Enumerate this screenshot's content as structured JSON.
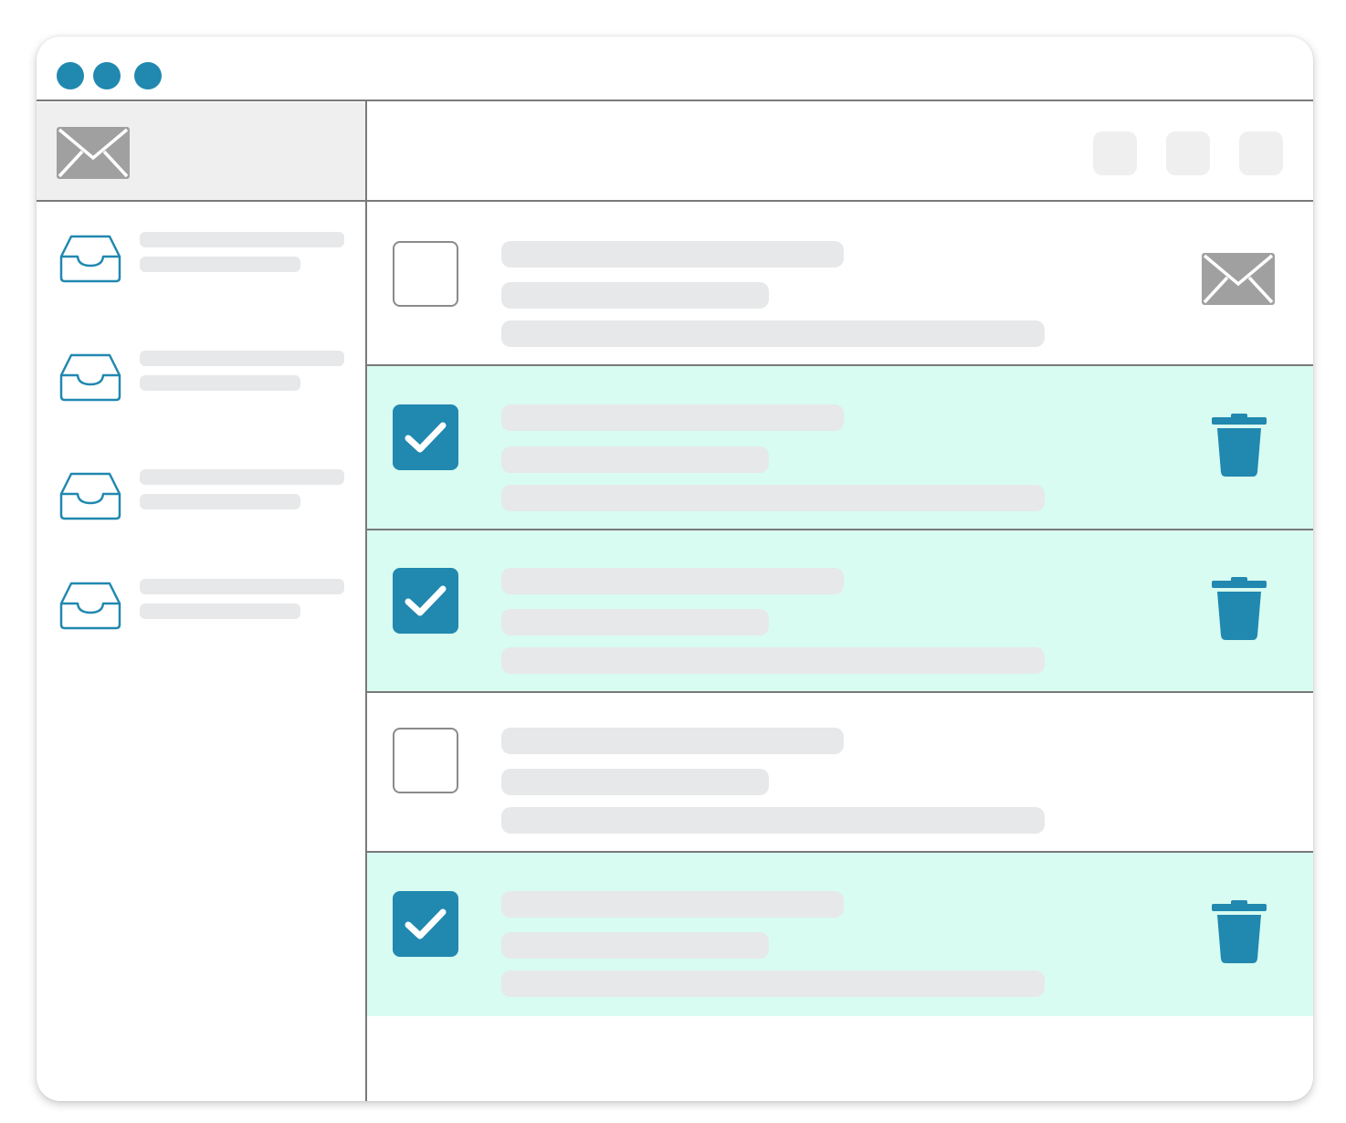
{
  "colors": {
    "accent": "#2188b0",
    "selected_row_bg": "#d8fcf1",
    "envelope_gray": "#a0a0a0"
  },
  "icons": {
    "window_controls": [
      "window-dot-icon",
      "window-dot-icon",
      "window-dot-icon"
    ],
    "app_logo": "envelope-icon",
    "folder": "inbox-tray-icon",
    "row_unread": "envelope-icon",
    "row_delete": "trash-icon",
    "checkbox_checked": "checkmark-icon"
  },
  "sidebar": {
    "folders": [
      {
        "icon": "inbox-tray-icon"
      },
      {
        "icon": "inbox-tray-icon"
      },
      {
        "icon": "inbox-tray-icon"
      },
      {
        "icon": "inbox-tray-icon"
      }
    ]
  },
  "toolbar": {
    "buttons": [
      {
        "label": ""
      },
      {
        "label": ""
      },
      {
        "label": ""
      }
    ]
  },
  "messages": [
    {
      "selected": false,
      "action_icon": "envelope-icon"
    },
    {
      "selected": true,
      "action_icon": "trash-icon"
    },
    {
      "selected": true,
      "action_icon": "trash-icon"
    },
    {
      "selected": false,
      "action_icon": ""
    },
    {
      "selected": true,
      "action_icon": "trash-icon"
    }
  ]
}
